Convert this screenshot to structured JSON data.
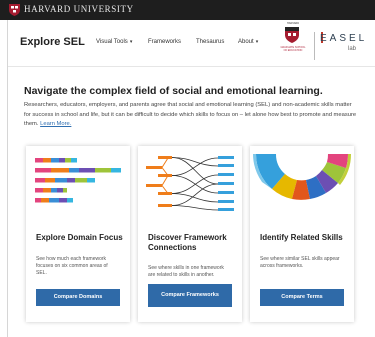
{
  "university": {
    "name": "HARVARD UNIVERSITY"
  },
  "header": {
    "brand": "Explore SEL",
    "nav": [
      {
        "label": "Visual Tools",
        "has_caret": true
      },
      {
        "label": "Frameworks",
        "has_caret": false
      },
      {
        "label": "Thesaurus",
        "has_caret": false
      },
      {
        "label": "About",
        "has_caret": true
      }
    ],
    "hgse_top": "HARVARD",
    "hgse_text": "GRADUATE SCHOOL OF EDUCATION",
    "easel": "EASEL",
    "lab": "lab"
  },
  "hero": {
    "title": "Navigate the complex field of social and emotional learning.",
    "text": "Researchers, educators, employers, and parents agree that social and emotional learning (SEL) and non-academic skills matter for success in school and life, but it can be difficult to decide which skills to focus on – let alone how best to promote and measure them.",
    "link": "Learn More."
  },
  "cards": [
    {
      "title": "Explore Domain Focus",
      "desc": "See how much each framework focuses on six common areas of SEL.",
      "button": "Compare Domains",
      "icon": "stacked-bars-figure"
    },
    {
      "title": "Discover Framework Connections",
      "desc": "See where skills in one framework are related to skills in another.",
      "button": "Compare Frameworks",
      "icon": "connections-figure"
    },
    {
      "title": "Identify Related Skills",
      "desc": "See where similar SEL skills appear across frameworks.",
      "button": "Compare Terms",
      "icon": "sunburst-figure"
    }
  ],
  "colors": {
    "univ_bar": "#1e1e1e",
    "crimson": "#a51c30",
    "button": "#2f6aa8",
    "link": "#2f6eb0",
    "orange": "#ef7d1a",
    "blue": "#35a0dc"
  }
}
